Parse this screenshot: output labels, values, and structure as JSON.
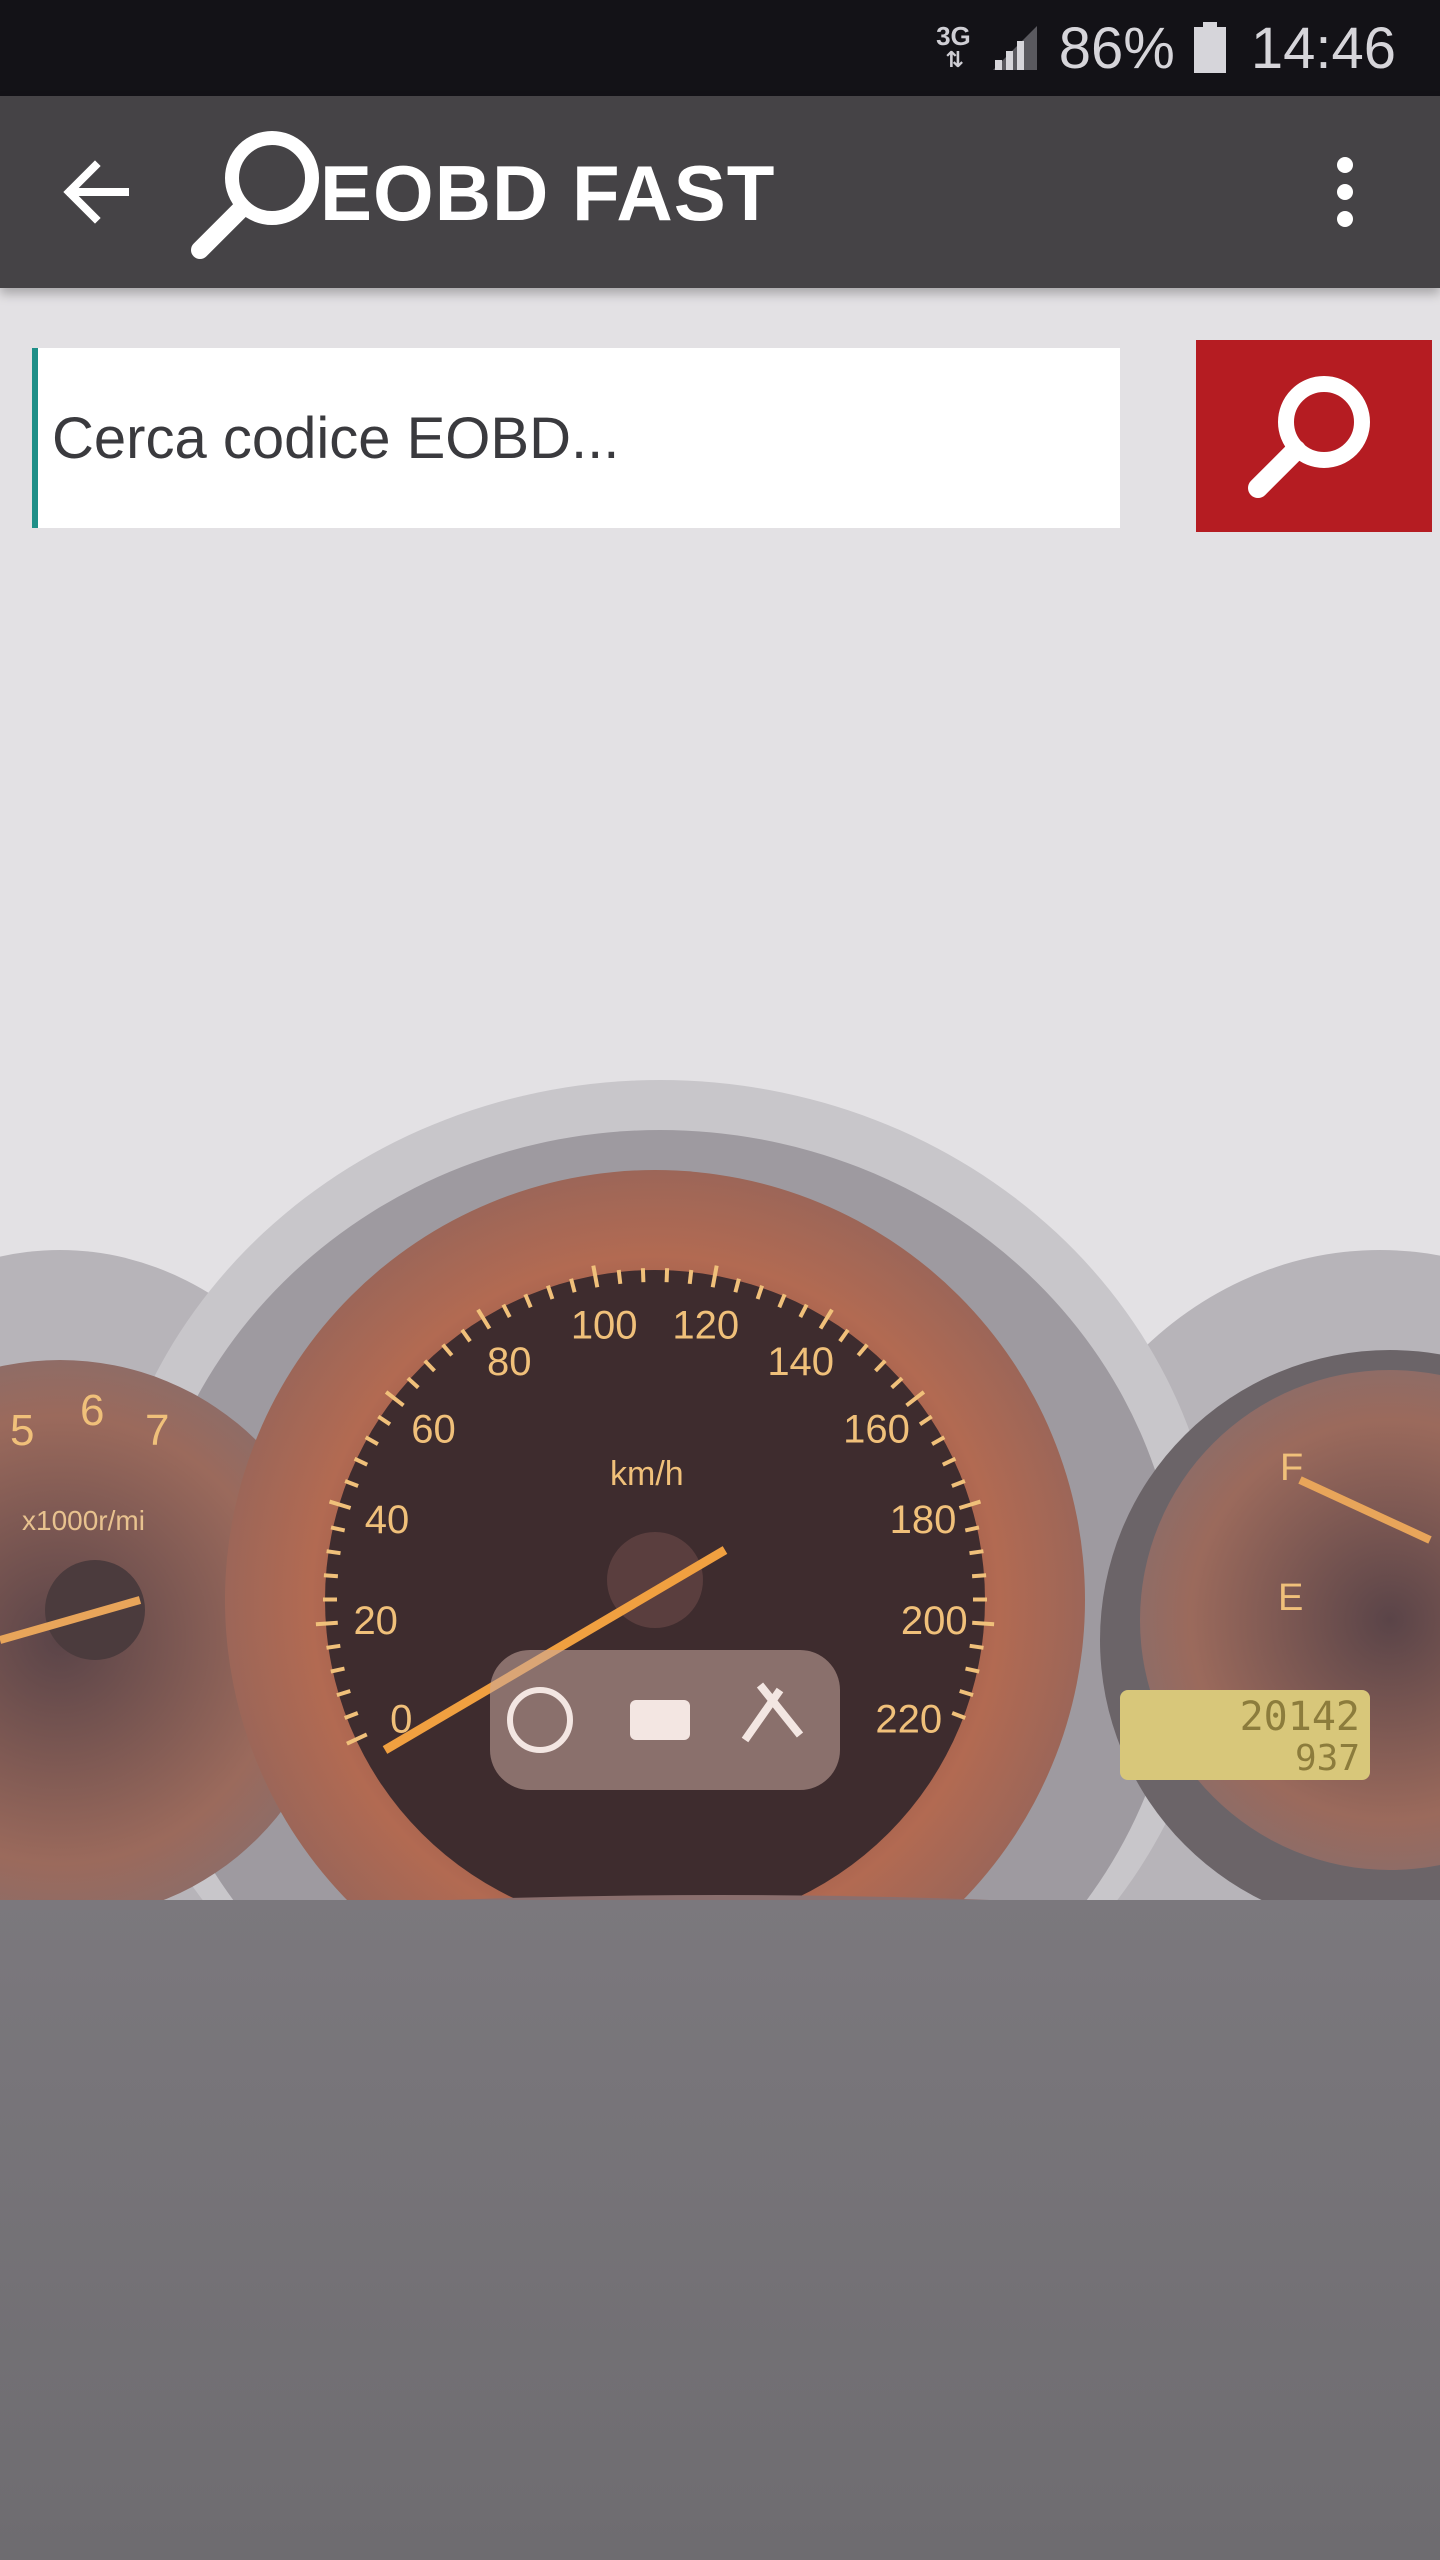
{
  "status_bar": {
    "network_type": "3G",
    "battery_percent": "86%",
    "time": "14:46",
    "icons": [
      "data-arrows-icon",
      "signal-icon",
      "battery-icon"
    ]
  },
  "app_bar": {
    "title": "EOBD FAST",
    "back_icon": "arrow-left-icon",
    "logo_icon": "magnifier-logo-icon",
    "menu_icon": "more-vert-icon"
  },
  "search": {
    "placeholder": "Cerca codice EOBD...",
    "value": "",
    "button_icon": "search-icon",
    "button_color": "#b51c22"
  },
  "dashboard": {
    "speed_unit": "km/h",
    "speed_ticks": [
      "0",
      "20",
      "40",
      "60",
      "80",
      "100",
      "120",
      "140",
      "160",
      "180",
      "200",
      "220"
    ],
    "tach_ticks": [
      "5",
      "6",
      "7"
    ],
    "tach_unit": "x1000r/mi",
    "fuel_full": "F",
    "fuel_empty": "E",
    "odometer": "20142",
    "trip": "937",
    "accent_color": "#e0a050"
  }
}
